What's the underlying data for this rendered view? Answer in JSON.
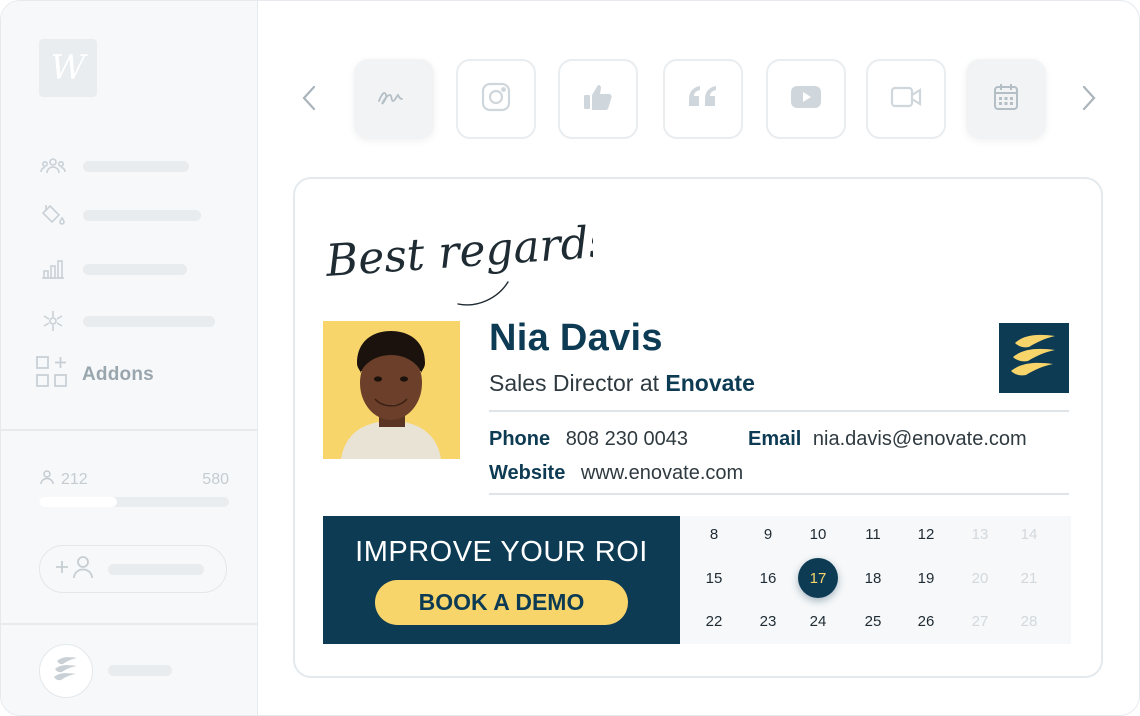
{
  "sidebar": {
    "logo_letter": "W",
    "nav_icons": [
      "team-icon",
      "paint-bucket-icon",
      "bar-chart-icon",
      "integrations-icon"
    ],
    "addons_label": "Addons",
    "users_count": "212",
    "users_limit": "580",
    "users_progress": 0.41
  },
  "toolbar": {
    "prev_icon": "chevron-left-icon",
    "next_icon": "chevron-right-icon",
    "tiles": [
      "signoff-icon",
      "instagram-icon",
      "thumbs-up-icon",
      "quote-icon",
      "youtube-icon",
      "video-icon",
      "calendar-icon"
    ]
  },
  "signature": {
    "closing": "Best regards,",
    "name": "Nia Davis",
    "title": "Sales Director at",
    "company": "Enovate",
    "phone_label": "Phone",
    "phone": "808 230 0043",
    "email_label": "Email",
    "email": "nia.davis@enovate.com",
    "website_label": "Website",
    "website": "www.enovate.com"
  },
  "banner": {
    "headline": "IMPROVE YOUR ROI",
    "cta": "BOOK A DEMO"
  },
  "calendar": {
    "rows": [
      [
        "8",
        "9",
        "10",
        "11",
        "12",
        "13",
        "14"
      ],
      [
        "15",
        "16",
        "17",
        "18",
        "19",
        "20",
        "21"
      ],
      [
        "22",
        "23",
        "24",
        "25",
        "26",
        "27",
        "28"
      ]
    ],
    "selected": "17",
    "muted_columns": [
      5,
      6
    ]
  },
  "colors": {
    "navy": "#0d3b54",
    "yellow": "#f7d56b",
    "sidebar_bg": "#f6f8fa"
  }
}
